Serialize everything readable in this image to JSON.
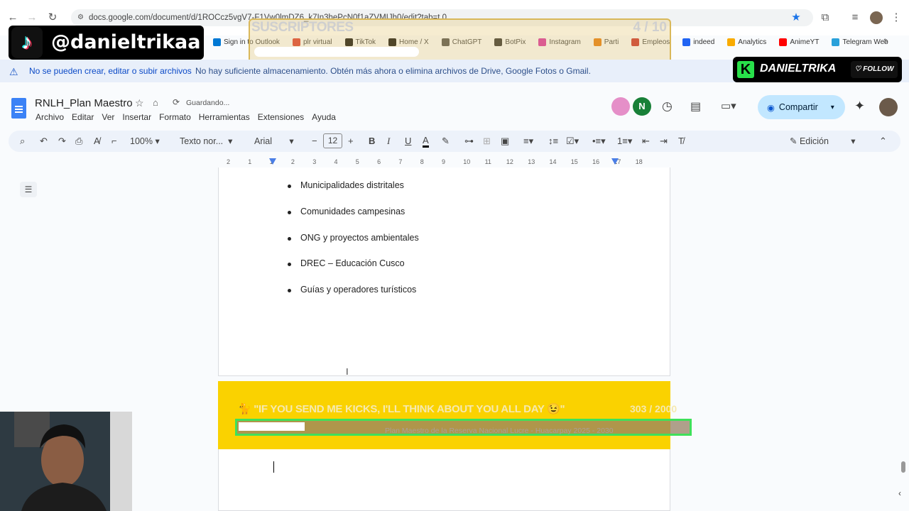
{
  "browser": {
    "url": "docs.google.com/document/d/1ROCcz5vgV7-F1Vw0lmDZ6_k7In3hePcN0f1aZVMIJh0/edit?tab=t.0",
    "bookmarks": [
      {
        "label": "Sign in to Outlook",
        "color": "#0078d4"
      },
      {
        "label": "plr virtual",
        "color": "#d93025"
      },
      {
        "label": "TikTok",
        "color": "#000000"
      },
      {
        "label": "Home / X",
        "color": "#000000"
      },
      {
        "label": "ChatGPT",
        "color": "#444444"
      },
      {
        "label": "BotPix",
        "color": "#222222"
      },
      {
        "label": "Instagram",
        "color": "#d6249f"
      },
      {
        "label": "Parti",
        "color": "#e37400"
      },
      {
        "label": "Empleos",
        "color": "#c5221f"
      },
      {
        "label": "indeed",
        "color": "#2164f3"
      },
      {
        "label": "Analytics",
        "color": "#f9ab00"
      },
      {
        "label": "AnimeYT",
        "color": "#ff0000"
      },
      {
        "label": "Telegram Web",
        "color": "#2aa1da"
      }
    ]
  },
  "overlay": {
    "tiktok_handle": "@danieltrikaa",
    "subs_label": "SUSCRIPTORES",
    "subs_count": "4 / 10",
    "kick_name": "DANIELTRIKA",
    "follow_label": "FOLLOW",
    "kicks_message": "🐈 \"IF YOU SEND ME KICKS, I'LL THINK ABOUT YOU ALL DAY 😉\"",
    "kicks_count": "303 / 2000",
    "kicks_progress_fraction": 0.15,
    "subs_progress_fraction": 0.4
  },
  "warning": {
    "bold": "No se pueden crear, editar o subir archivos",
    "text": "No hay suficiente almacenamiento. Obtén más ahora o elimina archivos de Drive, Google Fotos o Gmail."
  },
  "doc": {
    "title": "RNLH_Plan Maestro",
    "status": "Guardando...",
    "menu": [
      "Archivo",
      "Editar",
      "Ver",
      "Insertar",
      "Formato",
      "Herramientas",
      "Extensiones",
      "Ayuda"
    ],
    "share_label": "Compartir",
    "avatar_letter": "N"
  },
  "toolbar": {
    "zoom": "100%",
    "style": "Texto nor...",
    "font": "Arial",
    "font_size": "12",
    "mode": "Edición"
  },
  "ruler": [
    "2",
    "1",
    "1",
    "2",
    "3",
    "4",
    "5",
    "6",
    "7",
    "8",
    "9",
    "10",
    "11",
    "12",
    "13",
    "14",
    "15",
    "16",
    "17",
    "18"
  ],
  "content": {
    "bullets": [
      "Municipalidades distritales",
      "Comunidades campesinas",
      "ONG y proyectos ambientales",
      "DREC – Educación Cusco",
      "Guías y operadores turísticos"
    ],
    "page_header": "Plan Maestro de la Reserva Nacional Lucre - Huacarpay 2025 - 2030"
  }
}
